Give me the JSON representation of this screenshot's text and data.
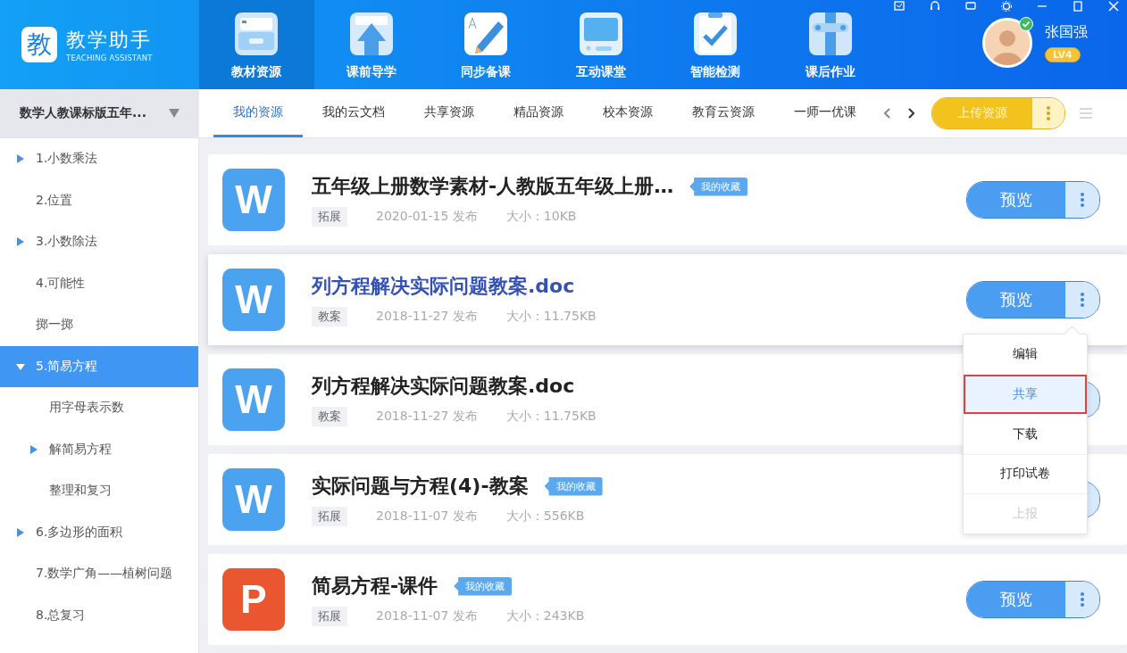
{
  "app": {
    "name": "教学助手",
    "subtitle": "TEACHING ASSISTANT",
    "logo_char": "教"
  },
  "nav": [
    {
      "label": "教材资源",
      "selected": true
    },
    {
      "label": "课前导学",
      "selected": false
    },
    {
      "label": "同步备课",
      "selected": false
    },
    {
      "label": "互动课堂",
      "selected": false
    },
    {
      "label": "智能检测",
      "selected": false
    },
    {
      "label": "课后作业",
      "selected": false
    }
  ],
  "user": {
    "name": "张国强",
    "level": "LV4",
    "online": true
  },
  "book_select": {
    "value": "数学人教课标版五年..."
  },
  "tabs": [
    {
      "label": "我的资源",
      "selected": true
    },
    {
      "label": "我的云文档",
      "selected": false
    },
    {
      "label": "共享资源",
      "selected": false
    },
    {
      "label": "精品资源",
      "selected": false
    },
    {
      "label": "校本资源",
      "selected": false
    },
    {
      "label": "教育云资源",
      "selected": false
    },
    {
      "label": "一师一优课",
      "selected": false
    }
  ],
  "upload_button": "上传资源",
  "sidebar": {
    "items": [
      {
        "label": "1.小数乘法",
        "expanded": false,
        "selected": false
      },
      {
        "label": "2.位置",
        "selected": false
      },
      {
        "label": "3.小数除法",
        "expanded": false,
        "selected": false
      },
      {
        "label": "4.可能性",
        "selected": false
      },
      {
        "label": "掷一掷",
        "selected": false
      },
      {
        "label": "5.简易方程",
        "expanded": true,
        "selected": true,
        "children": [
          {
            "label": "用字母表示数",
            "selected": false
          },
          {
            "label": "解简易方程",
            "expanded": false,
            "selected": false
          },
          {
            "label": "整理和复习",
            "selected": false
          }
        ]
      },
      {
        "label": "6.多边形的面积",
        "expanded": false,
        "selected": false
      },
      {
        "label": "7.数学广角——植树问题",
        "selected": false
      },
      {
        "label": "8.总复习",
        "selected": false
      }
    ]
  },
  "resources": [
    {
      "kind": "word",
      "icon_letter": "W",
      "title": "五年级上册数学素材-人教版五年级上册…",
      "favorite": "我的收藏",
      "category": "拓展",
      "date": "2020-01-15 发布",
      "size": "大小：10KB",
      "preview": "预览",
      "highlighted": false
    },
    {
      "kind": "word",
      "icon_letter": "W",
      "title": "列方程解决实际问题教案.doc",
      "category": "教案",
      "date": "2018-11-27 发布",
      "size": "大小：11.75KB",
      "preview": "预览",
      "highlighted": true
    },
    {
      "kind": "word",
      "icon_letter": "W",
      "title": "列方程解决实际问题教案.doc",
      "category": "教案",
      "date": "2018-11-27 发布",
      "size": "大小：11.75KB",
      "highlighted": false
    },
    {
      "kind": "word",
      "icon_letter": "W",
      "title": "实际问题与方程(4)-教案",
      "favorite": "我的收藏",
      "category": "拓展",
      "date": "2018-11-07 发布",
      "size": "大小：556KB",
      "highlighted": false
    },
    {
      "kind": "ppt",
      "icon_letter": "P",
      "title": "简易方程-课件",
      "favorite": "我的收藏",
      "category": "拓展",
      "date": "2018-11-07 发布",
      "size": "大小：243KB",
      "preview": "预览",
      "highlighted": false
    }
  ],
  "context_menu": {
    "items": [
      {
        "label": "编辑",
        "selected": false,
        "disabled": false
      },
      {
        "label": "共享",
        "selected": true,
        "disabled": false
      },
      {
        "label": "下载",
        "selected": false,
        "disabled": false
      },
      {
        "label": "打印试卷",
        "selected": false,
        "disabled": false
      },
      {
        "label": "上报",
        "selected": false,
        "disabled": true
      }
    ]
  }
}
